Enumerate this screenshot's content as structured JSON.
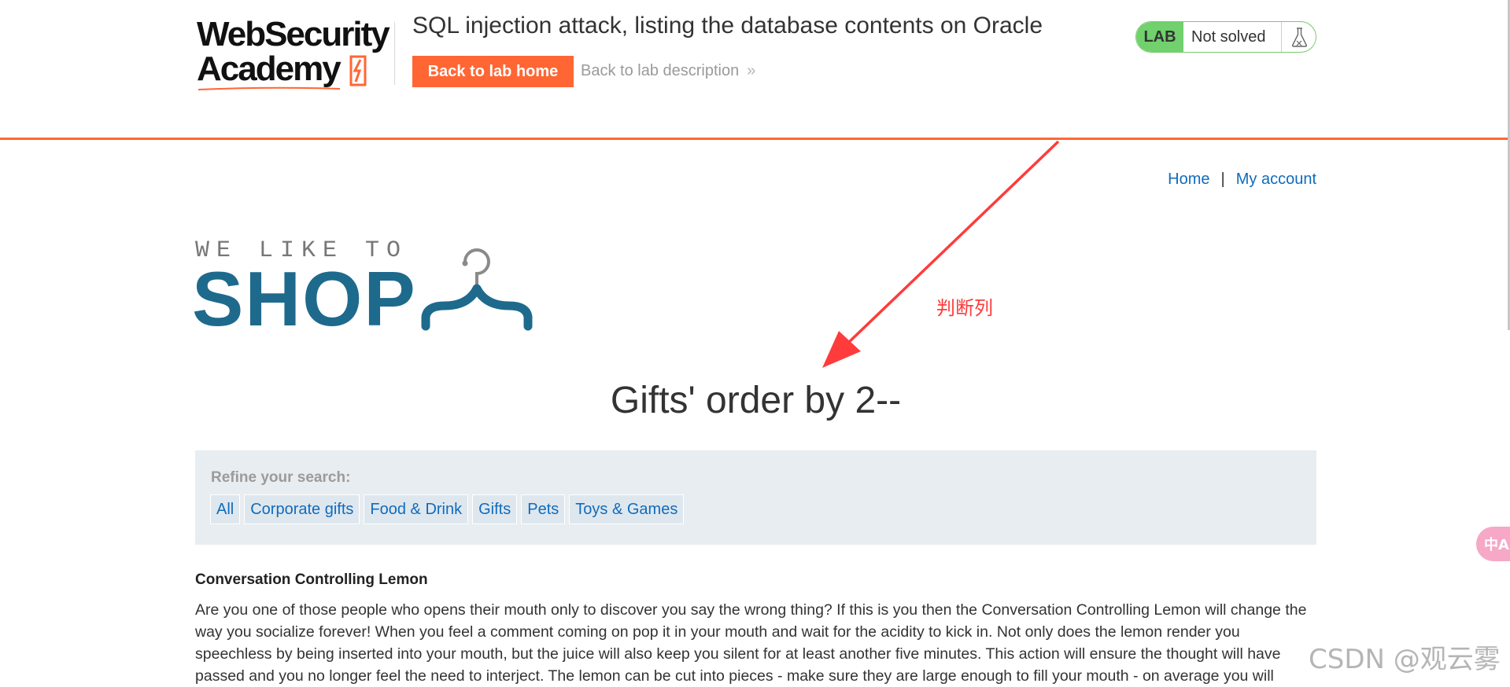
{
  "academy": {
    "logo": {
      "line1": "WebSecurity",
      "line2": "Academy"
    },
    "lab_title": "SQL injection attack, listing the database contents on Oracle",
    "back_home_label": "Back to lab home",
    "back_description_label": "Back to lab description",
    "back_description_chevron": "»",
    "status": {
      "badge": "LAB",
      "text": "Not solved"
    },
    "accent_color": "#ff6633"
  },
  "nav": {
    "home": "Home",
    "separator": "|",
    "account": "My account"
  },
  "banner": {
    "tagline": "WE LIKE TO",
    "shop": "SHOP"
  },
  "heading": "Gifts' order by 2--",
  "annotation": {
    "text": "判断列",
    "color": "#ff3b3b"
  },
  "filter": {
    "label": "Refine your search:",
    "categories": [
      "All",
      "Corporate gifts",
      "Food & Drink",
      "Gifts",
      "Pets",
      "Toys & Games"
    ]
  },
  "product": {
    "title": "Conversation Controlling Lemon",
    "description": "Are you one of those people who opens their mouth only to discover you say the wrong thing? If this is you then the Conversation Controlling Lemon will change the way you socialize forever! When you feel a comment coming on pop it in your mouth and wait for the acidity to kick in. Not only does the lemon render you speechless by being inserted into your mouth, but the juice will also keep you silent for at least another five minutes. This action will ensure the thought will have passed and you no longer feel the need to interject. The lemon can be cut into pieces - make sure they are large enough to fill your mouth - on average you will"
  },
  "overlay": {
    "translate_glyph": "中A",
    "watermark": "CSDN @观云雾"
  }
}
